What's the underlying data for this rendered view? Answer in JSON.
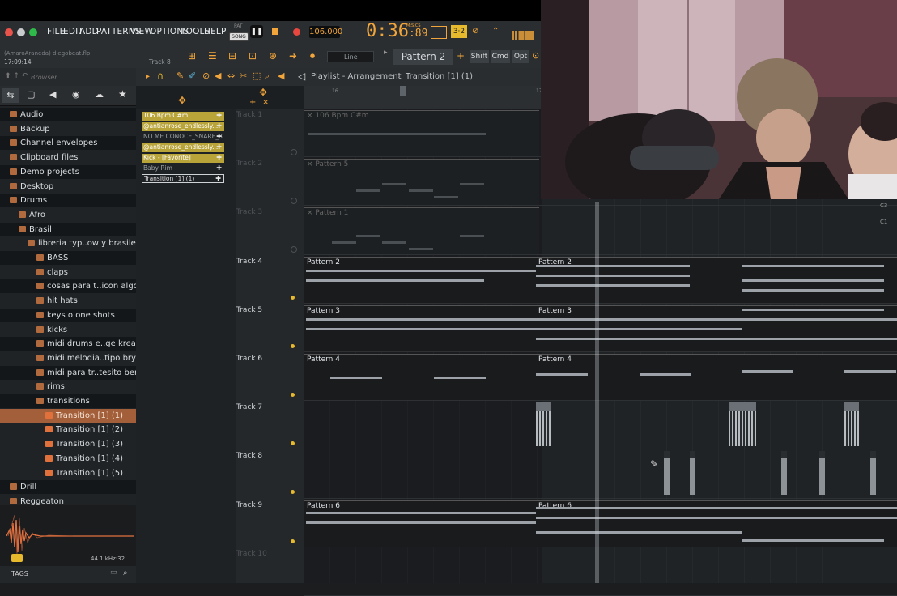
{
  "menubar": {
    "items": [
      "FILE",
      "EDIT",
      "ADD",
      "PATTERNS",
      "VIEW",
      "OPTIONS",
      "TOOLS",
      "HELP"
    ],
    "pat_label": "PAT",
    "song_label": "SONG",
    "tempo": "106.000",
    "time": "0:36",
    "time_sub": ":89",
    "time_unit": "M:S:CS",
    "project_path": "(AmaroAraneda) diegobeat.flp",
    "project_time": "17:09:14",
    "track_label": "Track 8",
    "snap": "Line",
    "pattern_selector": "Pattern 2",
    "shift": "Shift",
    "cmd": "Cmd",
    "opt": "Opt"
  },
  "browser": {
    "search_placeholder": "Browser",
    "items": [
      {
        "label": "Audio",
        "indent": 0,
        "dark": true
      },
      {
        "label": "Backup",
        "indent": 0,
        "dark": false
      },
      {
        "label": "Channel envelopes",
        "indent": 0,
        "dark": true
      },
      {
        "label": "Clipboard files",
        "indent": 0,
        "dark": false
      },
      {
        "label": "Demo projects",
        "indent": 0,
        "dark": true
      },
      {
        "label": "Desktop",
        "indent": 0,
        "dark": false
      },
      {
        "label": "Drums",
        "indent": 0,
        "dark": true
      },
      {
        "label": "Afro",
        "indent": 1,
        "dark": false
      },
      {
        "label": "Brasil",
        "indent": 1,
        "dark": true
      },
      {
        "label": "libreria typ..ow y brasileño",
        "indent": 2,
        "dark": false
      },
      {
        "label": "BASS",
        "indent": 3,
        "dark": true
      },
      {
        "label": "claps",
        "indent": 3,
        "dark": false
      },
      {
        "label": "cosas para t..icon algo asi",
        "indent": 3,
        "dark": true
      },
      {
        "label": "hit hats",
        "indent": 3,
        "dark": false
      },
      {
        "label": "keys o one shots",
        "indent": 3,
        "dark": true
      },
      {
        "label": "kicks",
        "indent": 3,
        "dark": false
      },
      {
        "label": "midi drums e..ge kreamly",
        "indent": 3,
        "dark": true
      },
      {
        "label": "midi melodia..tipo bryartz",
        "indent": 3,
        "dark": false
      },
      {
        "label": "midi para tr..tesito beny o",
        "indent": 3,
        "dark": true
      },
      {
        "label": "rims",
        "indent": 3,
        "dark": false
      },
      {
        "label": "transitions",
        "indent": 3,
        "dark": true
      }
    ],
    "files": [
      "Transition [1] (1)",
      "Transition [1] (2)",
      "Transition [1] (3)",
      "Transition [1] (4)",
      "Transition [1] (5)"
    ],
    "after": [
      "Drill",
      "Reggeaton"
    ],
    "sample_rate": "44.1 kHz:32",
    "tags_label": "TAGS"
  },
  "playlist": {
    "title": "Playlist - Arrangement",
    "breadcrumb": "Transition [1] (1)",
    "ruler_mark": "16",
    "ruler_mark2": "17",
    "picker": [
      {
        "label": "106 Bpm C#m",
        "style": "gold"
      },
      {
        "label": "@antianrose_endlessly...",
        "style": "gold"
      },
      {
        "label": "NO ME CONOCE_SNARE_3",
        "style": "plain"
      },
      {
        "label": "@antianrose_endlessly...",
        "style": "gold"
      },
      {
        "label": "Kick - [Favorite]",
        "style": "gold"
      },
      {
        "label": "Baby Rim",
        "style": "plain"
      },
      {
        "label": "Transition [1] (1)",
        "style": "selected"
      }
    ],
    "tracks": [
      {
        "name": "Track 1",
        "dim": true,
        "clip": "× 106 Bpm C#m"
      },
      {
        "name": "Track 2",
        "dim": true,
        "clip": "× Pattern 5"
      },
      {
        "name": "Track 3",
        "dim": true,
        "clip": "× Pattern 1"
      },
      {
        "name": "Track 4",
        "dim": false,
        "clip": "Pattern 2",
        "clip2": "Pattern 2"
      },
      {
        "name": "Track 5",
        "dim": false,
        "clip": "Pattern 3",
        "clip2": "Pattern 3"
      },
      {
        "name": "Track 6",
        "dim": false,
        "clip": "Pattern 4",
        "clip2": "Pattern 4"
      },
      {
        "name": "Track 7",
        "dim": false,
        "clip": "",
        "clip2": ""
      },
      {
        "name": "Track 8",
        "dim": false,
        "clip": "",
        "clip2": ""
      },
      {
        "name": "Track 9",
        "dim": false,
        "clip": "Pattern 6",
        "clip2": "Pattern 6"
      },
      {
        "name": "Track 10",
        "dim": true,
        "clip": ""
      }
    ],
    "piano_labels": [
      "C3",
      "C1"
    ]
  },
  "colors": {
    "accent": "#f2a53a",
    "gold_clip": "#b9a43a",
    "selected": "#a35f3a"
  }
}
